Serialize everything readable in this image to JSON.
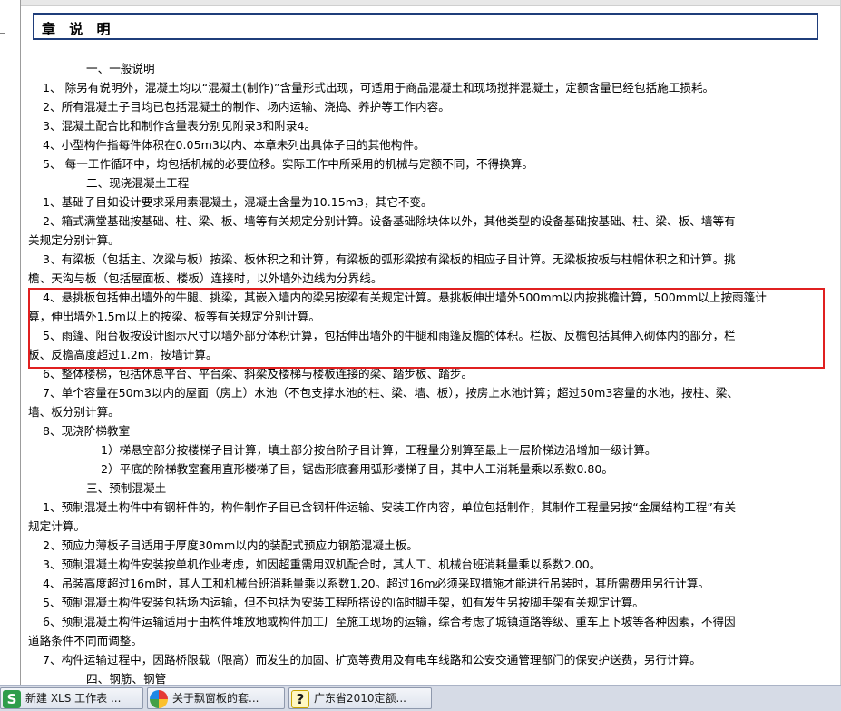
{
  "document": {
    "title": "章 说 明",
    "lines": [
      {
        "indent": 56,
        "text": "一、一般说明"
      },
      {
        "indent": 8,
        "text": "1、    除另有说明外，混凝土均以“混凝土(制作)”含量形式出现，可适用于商品混凝土和现场搅拌混凝土，定额含量已经包括施工损耗。"
      },
      {
        "indent": 8,
        "text": "2、所有混凝土子目均已包括混凝土的制作、场内运输、浇捣、养护等工作内容。"
      },
      {
        "indent": 8,
        "text": "3、混凝土配合比和制作含量表分别见附录3和附录4。"
      },
      {
        "indent": 8,
        "text": "4、小型构件指每件体积在0.05m3以内、本章未列出具体子目的其他构件。"
      },
      {
        "indent": 8,
        "text": "5、    每一工作循环中，均包括机械的必要位移。实际工作中所采用的机械与定额不同，不得换算。"
      },
      {
        "indent": 56,
        "text": "二、现浇混凝土工程"
      },
      {
        "indent": 8,
        "text": "1、基础子目如设计要求采用素混凝土，混凝土含量为10.15m3，其它不变。"
      },
      {
        "indent": 8,
        "text": "2、箱式满堂基础按基础、柱、梁、板、墙等有关规定分别计算。设备基础除块体以外，其他类型的设备基础按基础、柱、梁、板、墙等有"
      },
      {
        "indent": -8,
        "text": "关规定分别计算。"
      },
      {
        "indent": 8,
        "text": "3、有梁板（包括主、次梁与板）按梁、板体积之和计算，有梁板的弧形梁按有梁板的相应子目计算。无梁板按板与柱帽体积之和计算。挑"
      },
      {
        "indent": -8,
        "text": "檐、天沟与板（包括屋面板、楼板）连接时，以外墙外边线为分界线。"
      },
      {
        "indent": 8,
        "text": "4、悬挑板包括伸出墙外的牛腿、挑梁，其嵌入墙内的梁另按梁有关规定计算。悬挑板伸出墙外500mm以内按挑檐计算，500mm以上按雨篷计"
      },
      {
        "indent": -8,
        "text": "算，伸出墙外1.5m以上的按梁、板等有关规定分别计算。"
      },
      {
        "indent": 8,
        "text": "5、雨篷、阳台板按设计图示尺寸以墙外部分体积计算，包括伸出墙外的牛腿和雨篷反檐的体积。栏板、反檐包括其伸入砌体内的部分，栏"
      },
      {
        "indent": -8,
        "text": "板、反檐高度超过1.2m，按墙计算。"
      },
      {
        "indent": 8,
        "text": "6、整体楼梯，包括休息平台、平台梁、斜梁及楼梯与楼板连接的梁、踏步板、踏步。"
      },
      {
        "indent": 8,
        "text": "7、单个容量在50m3以内的屋面（房上）水池（不包支撑水池的柱、梁、墙、板），按房上水池计算；超过50m3容量的水池，按柱、梁、"
      },
      {
        "indent": -8,
        "text": "墙、板分别计算。"
      },
      {
        "indent": 8,
        "text": "8、现浇阶梯教室"
      },
      {
        "indent": 72,
        "text": "1）梯悬空部分按楼梯子目计算，填土部分按台阶子目计算，工程量分别算至最上一层阶梯边沿增加一级计算。"
      },
      {
        "indent": 72,
        "text": "2）平底的阶梯教室套用直形楼梯子目，锯齿形底套用弧形楼梯子目，其中人工消耗量乘以系数0.80。"
      },
      {
        "indent": 56,
        "text": "三、预制混凝土"
      },
      {
        "indent": 8,
        "text": "1、预制混凝土构件中有钢杆件的，构件制作子目已含钢杆件运输、安装工作内容，单位包括制作，其制作工程量另按“金属结构工程”有关"
      },
      {
        "indent": -8,
        "text": "规定计算。"
      },
      {
        "indent": 8,
        "text": "2、预应力薄板子目适用于厚度30mm以内的装配式预应力钢筋混凝土板。"
      },
      {
        "indent": 8,
        "text": "3、预制混凝土构件安装按单机作业考虑，如因超重需用双机配合时，其人工、机械台班消耗量乘以系数2.00。"
      },
      {
        "indent": 8,
        "text": "4、吊装高度超过16m时，其人工和机械台班消耗量乘以系数1.20。超过16m必须采取措施才能进行吊装时，其所需费用另行计算。"
      },
      {
        "indent": 8,
        "text": "5、预制混凝土构件安装包括场内运输，但不包括为安装工程所搭设的临时脚手架，如有发生另按脚手架有关规定计算。"
      },
      {
        "indent": 8,
        "text": "6、预制混凝土构件运输适用于由构件堆放地或构件加工厂至施工现场的运输，综合考虑了城镇道路等级、重车上下坡等各种因素，不得因"
      },
      {
        "indent": -8,
        "text": "道路条件不同而调整。"
      },
      {
        "indent": 8,
        "text": "7、构件运输过程中，因路桥限载（限高）而发生的加固、扩宽等费用及有电车线路和公安交通管理部门的保安护送费，另行计算。"
      },
      {
        "indent": 56,
        "text": "四、钢筋、钢管"
      }
    ]
  },
  "taskbar": {
    "items": [
      {
        "icon": "wps-spreadsheet-icon",
        "glyph": "S",
        "label": "新建 XLS 工作表 ..."
      },
      {
        "icon": "browser-icon",
        "glyph": "",
        "label": "关于飘窗板的套..."
      },
      {
        "icon": "help-file-icon",
        "glyph": "?",
        "label": "广东省2010定额..."
      }
    ]
  },
  "colors": {
    "title_border": "#1f3d7a",
    "highlight_border": "#e02020",
    "taskbar_bg": "#d6dbe6"
  }
}
